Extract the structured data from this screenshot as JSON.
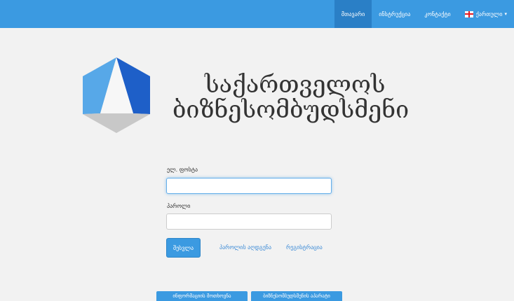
{
  "header": {
    "nav": [
      {
        "label": "მთავარი",
        "active": true
      },
      {
        "label": "ინსტრუქცია",
        "active": false
      },
      {
        "label": "კონტაქტი",
        "active": false
      }
    ],
    "language": {
      "label": "ქართული",
      "icon": "georgian-flag-icon"
    }
  },
  "brand": {
    "line1": "საქართველოს",
    "line2": "ბიზნესომბუდსმენი",
    "logo_icon": "hexagon-logo-icon"
  },
  "form": {
    "email_label": "ელ. ფოსტა",
    "email_value": "",
    "password_label": "პაროლი",
    "password_value": "",
    "login_button": "შესვლა",
    "forgot_password_link": "პაროლის აღდგენა",
    "register_link": "რეგისტრაცია"
  },
  "footer_buttons": [
    "ინფორმაციის მოთხოვნა",
    "ბიზნესომბუდსმენის აპარატი"
  ],
  "colors": {
    "accent": "#3b9ae1",
    "accent_dark": "#2a7fc6",
    "background": "#f2f2f2",
    "text": "#333333",
    "link": "#3b8ad6"
  }
}
